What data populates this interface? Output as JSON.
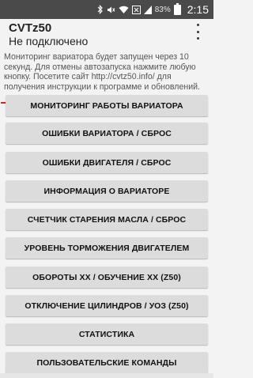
{
  "status_bar": {
    "battery_percent": "83%",
    "time": "2:15",
    "icons": [
      "bluetooth-icon",
      "mute-icon",
      "wifi-icon",
      "network-icon",
      "signal-icon",
      "battery-icon"
    ]
  },
  "app_bar": {
    "title": "CVTz50",
    "subtitle": "Не подключено",
    "menu_icon": "overflow-menu-icon"
  },
  "info_text": "Мониторинг вариатора будет запущен через 10 секунд. Для отмены автозапуска нажмите любую кнопку. Посетите сайт http://cvtz50.info/ для получения инструкции к программе и обновлений.",
  "buttons": [
    "МОНИТОРИНГ РАБОТЫ ВАРИАТОРА",
    "ОШИБКИ ВАРИАТОРА / СБРОС",
    "ОШИБКИ ДВИГАТЕЛЯ / СБРОС",
    "ИНФОРМАЦИЯ О ВАРИАТОРЕ",
    "СЧЕТЧИК СТАРЕНИЯ МАСЛА / СБРОС",
    "УРОВЕНЬ ТОРМОЖЕНИЯ ДВИГАТЕЛЕМ",
    "ОБОРОТЫ ХХ / ОБУЧЕНИЕ ХХ (Z50)",
    "ОТКЛЮЧЕНИЕ ЦИЛИНДРОВ / УОЗ (Z50)",
    "СТАТИСТИКА",
    "ПОЛЬЗОВАТЕЛЬСКИЕ КОМАНДЫ"
  ],
  "colors": {
    "status_bar": "#4a4a4a",
    "background": "#f3f3f3",
    "button": "#dcdcdc",
    "arrow": "#e0201b"
  }
}
